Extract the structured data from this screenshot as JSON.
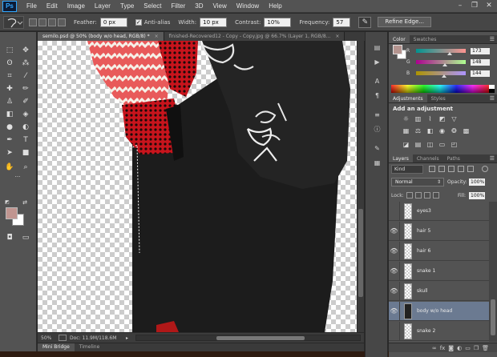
{
  "app": {
    "logo": "Ps"
  },
  "menu": [
    "File",
    "Edit",
    "Image",
    "Layer",
    "Type",
    "Select",
    "Filter",
    "3D",
    "View",
    "Window",
    "Help"
  ],
  "window_controls": {
    "minimize": "–",
    "restore": "❐",
    "close": "✕"
  },
  "options_bar": {
    "feather_label": "Feather:",
    "feather_value": "0 px",
    "antialias_label": "Anti-alias",
    "antialias_checked": "✓",
    "width_label": "Width:",
    "width_value": "10 px",
    "contrast_label": "Contrast:",
    "contrast_value": "10%",
    "frequency_label": "Frequency:",
    "frequency_value": "57",
    "refine_edge": "Refine Edge..."
  },
  "document_tabs": [
    {
      "label": "semilo.psd @ 50% (body w/o head, RGB/8) *",
      "close": "×"
    },
    {
      "label": "finished-Recovered12 - Copy - Copy.jpg @ 66.7% (Layer 1, RGB/8...",
      "close": "×"
    }
  ],
  "status_bar": {
    "zoom": "50%",
    "doc": "Doc: 11.9M/118.6M",
    "arrow": "▸"
  },
  "bottom_tabs": [
    "Mini Bridge",
    "Timeline"
  ],
  "color_panel": {
    "tabs": [
      "Color",
      "Swatches"
    ],
    "channels": [
      {
        "name": "R",
        "value": "173",
        "pos": 0.68
      },
      {
        "name": "G",
        "value": "148",
        "pos": 0.58
      },
      {
        "name": "B",
        "value": "144",
        "pos": 0.56
      }
    ],
    "fg_color": "#ad9490"
  },
  "adjustments_panel": {
    "tabs": [
      "Adjustments",
      "Styles"
    ],
    "title": "Add an adjustment"
  },
  "layers_panel": {
    "tabs": [
      "Layers",
      "Channels",
      "Paths"
    ],
    "kind": "Kind",
    "blend_mode": "Normal",
    "opacity_label": "Opacity:",
    "opacity_value": "100%",
    "lock_label": "Lock:",
    "fill_label": "Fill:",
    "fill_value": "100%",
    "layers": [
      {
        "name": "eyes3",
        "visible": false,
        "selected": false
      },
      {
        "name": "hair 5",
        "visible": true,
        "selected": false
      },
      {
        "name": "hair 6",
        "visible": true,
        "selected": false
      },
      {
        "name": "snake 1",
        "visible": true,
        "selected": false
      },
      {
        "name": "skull",
        "visible": true,
        "selected": false
      },
      {
        "name": "body w/o head",
        "visible": true,
        "selected": true
      },
      {
        "name": "snake 2",
        "visible": false,
        "selected": false
      }
    ]
  },
  "colors": {
    "ui_dark": "#535353",
    "selection": "#6b7a91",
    "robe": "#1c1c1c",
    "red": "#d41f28"
  }
}
